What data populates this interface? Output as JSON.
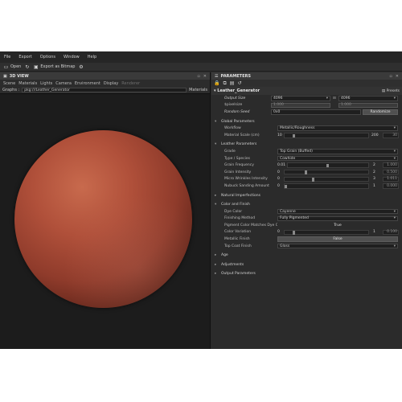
{
  "menu": [
    "File",
    "Export",
    "Options",
    "Window",
    "Help"
  ],
  "toolbar": {
    "open": "Open",
    "export": "Export as Bitmap"
  },
  "left_panel": {
    "title": "3D VIEW",
    "menu": [
      "Scene",
      "Materials",
      "Lights",
      "Camera",
      "Environment",
      "Display"
    ],
    "menu_dim": "Renderer",
    "graphs_label": "Graphs :",
    "graph_value": "pkg:///Leather_Generator",
    "materials_label": "Materials"
  },
  "right_panel": {
    "title": "PARAMETERS",
    "graph_name": "Leather_Generator",
    "presets": "Presets",
    "output_size": {
      "label": "Output Size",
      "w": "4096",
      "h": "4096"
    },
    "pixel_size": {
      "label": "$pixelsize",
      "a": "1.000",
      "b": "1.000"
    },
    "random_seed": {
      "label": "Random Seed",
      "value": "0x0",
      "button": "Randomize"
    },
    "sections": {
      "global": "Global Parameters",
      "leather": "Leather Parameters",
      "natural": "Natural Imperfections",
      "color": "Color and Finish",
      "age": "Age",
      "adjustments": "Adjustments",
      "output": "Output Parameters"
    },
    "workflow": {
      "label": "Workflow",
      "value": "Metallic/Roughness"
    },
    "material_scale": {
      "label": "Material Scale (cm)",
      "min": "10",
      "max": "200",
      "value": "30",
      "level": 0.1
    },
    "grade": {
      "label": "Grade",
      "value": "Top Grain (Buffed)"
    },
    "type_species": {
      "label": "Type / Species",
      "value": "Cowhide"
    },
    "grain_frequency": {
      "label": "Grain Frequency",
      "min": "0.01",
      "max": "2",
      "value": "1.000",
      "level": 0.5
    },
    "grain_intensity": {
      "label": "Grain Intensity",
      "min": "0",
      "max": "2",
      "value": "0.500",
      "level": 0.25
    },
    "micro_wrinkles": {
      "label": "Micro Wrinkles Intensity",
      "min": "0",
      "max": "3",
      "value": "1.011",
      "level": 0.337
    },
    "nubuck": {
      "label": "Nubuck Sanding Amount",
      "min": "0",
      "max": "1",
      "value": "0.000",
      "level": 0.0
    },
    "dye_color": {
      "label": "Dye Color",
      "value": "Cayenne"
    },
    "finishing_method": {
      "label": "Finishing Method",
      "value": "Fully Pigmented"
    },
    "pigment_match": {
      "label": "Pigment Color Matches Dye Color?",
      "value": "True"
    },
    "color_variation": {
      "label": "Color Variation",
      "min": "0",
      "max": "1",
      "value": "0.100",
      "level": 0.1
    },
    "metallic_finish": {
      "label": "Metallic Finish",
      "value": "False"
    },
    "top_coat": {
      "label": "Top Coat Finish",
      "value": "Gloss"
    }
  }
}
